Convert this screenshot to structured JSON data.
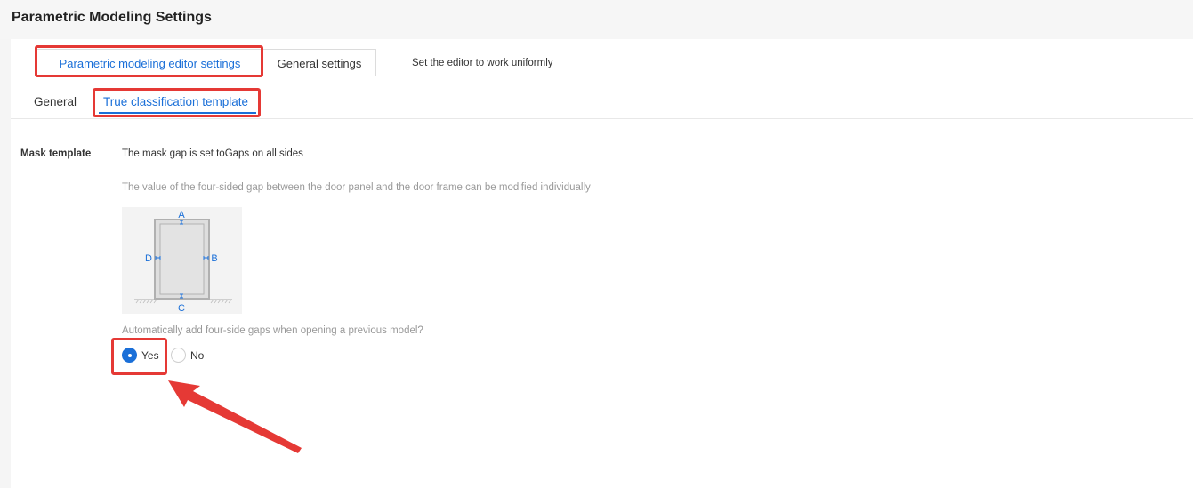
{
  "header": {
    "title": "Parametric Modeling Settings"
  },
  "top_tabs": [
    {
      "label": "Parametric modeling editor settings",
      "active": true
    },
    {
      "label": "General settings",
      "active": false
    }
  ],
  "top_tabs_note": "Set the editor to work uniformly",
  "sub_tabs": [
    {
      "label": "General",
      "active": false
    },
    {
      "label": "True classification template",
      "active": true
    }
  ],
  "mask_template": {
    "label": "Mask template",
    "setting": "The mask gap is set toGaps on all sides",
    "hint": "The value of the four-sided gap between the door panel and the door frame can be modified individually",
    "diagram_labels": {
      "top": "A",
      "right": "B",
      "bottom": "C",
      "left": "D"
    }
  },
  "auto_gap": {
    "question": "Automatically add four-side gaps when opening a previous model?",
    "options": [
      {
        "label": "Yes",
        "selected": true
      },
      {
        "label": "No",
        "selected": false
      }
    ]
  },
  "colors": {
    "accent": "#1a6fd8",
    "annotation": "#e53935",
    "hint_text": "#999999"
  }
}
